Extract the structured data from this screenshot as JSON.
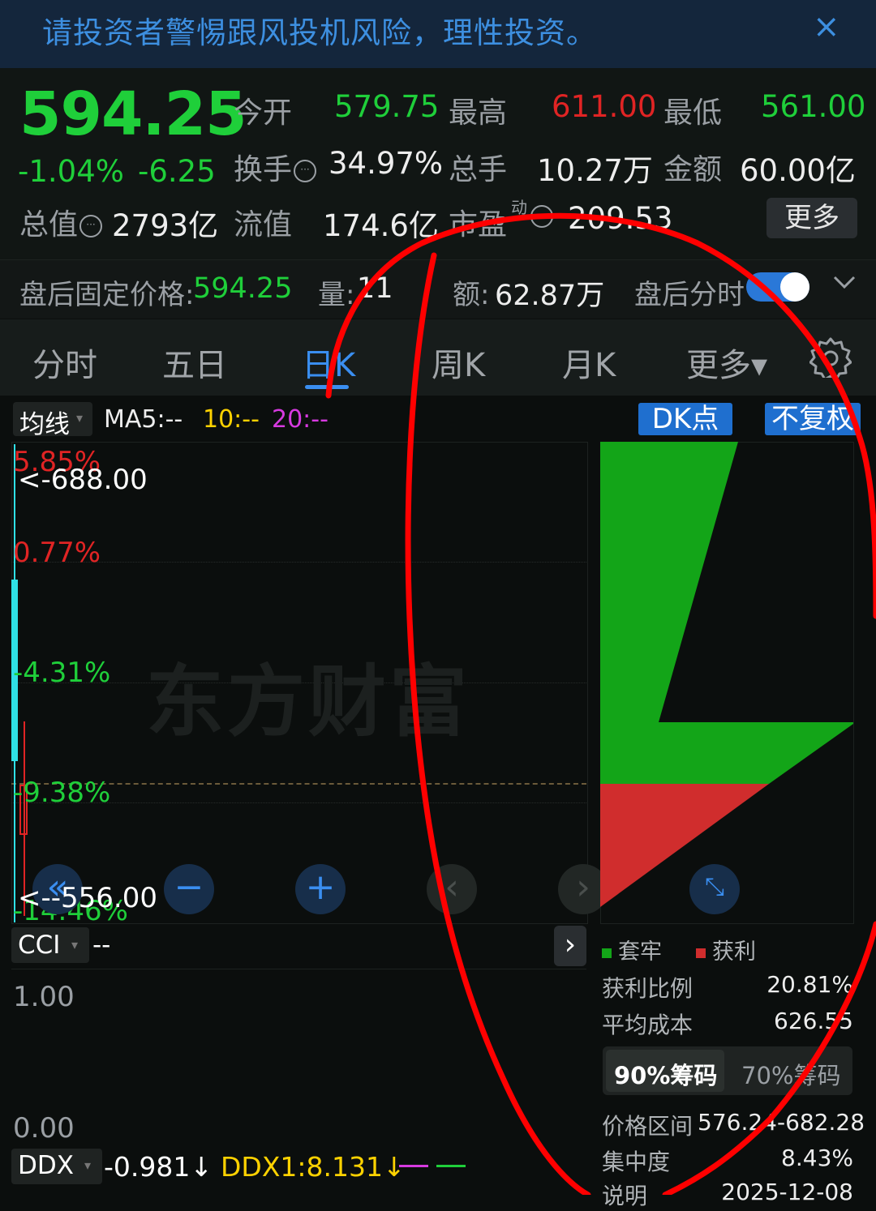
{
  "banner": {
    "text": "请投资者警惕跟风投机风险，理性投资。",
    "close_icon": "×"
  },
  "quote": {
    "price": "594.25",
    "change_pct": "-1.04%",
    "change": "-6.25",
    "open_label": "今开",
    "open": "579.75",
    "high_label": "最高",
    "high": "611.00",
    "low_label": "最低",
    "low": "561.00",
    "turnover_label": "换手",
    "turnover": "34.97%",
    "volume_label": "总手",
    "volume": "10.27万",
    "amount_label": "金额",
    "amount": "60.00亿",
    "mktcap_label": "总值",
    "mktcap": "2793亿",
    "float_label": "流值",
    "float_cap": "174.6亿",
    "pe_label": "市盈",
    "pe_sup": "动",
    "pe": "209.53",
    "more_label": "更多"
  },
  "afterhours": {
    "fixed_label": "盘后固定价格:",
    "fixed_price": "594.25",
    "vol_label": "量:",
    "vol": "11",
    "amt_label": "额:",
    "amt": "62.87万",
    "toggle_label": "盘后分时",
    "toggle_on": true
  },
  "tabs": [
    {
      "label": "分时"
    },
    {
      "label": "五日"
    },
    {
      "label": "日K",
      "active": true
    },
    {
      "label": "周K"
    },
    {
      "label": "月K"
    },
    {
      "label": "更多▾"
    }
  ],
  "toolbar": {
    "ma_select": "均线",
    "ma5": "MA5:--",
    "ma10": "10:--",
    "ma20": "20:--",
    "dk_badge": "DK点",
    "fq_badge": "不复权"
  },
  "kchart": {
    "high_marker": "<-688.00",
    "low_marker": "<--556.00",
    "pct_labels": [
      "5.85%",
      "0.77%",
      "-4.31%",
      "-9.38%",
      "-14.46%"
    ],
    "watermark": "东方财富"
  },
  "chip_legend": {
    "trapped": "套牢",
    "profit": "获利"
  },
  "chip_stats": {
    "profit_ratio_label": "获利比例",
    "profit_ratio": "20.81%",
    "avg_cost_label": "平均成本",
    "avg_cost": "626.55",
    "seg_90": "90%筹码",
    "seg_70": "70%筹码",
    "range_label": "价格区间",
    "range": "576.24-682.28",
    "concentration_label": "集中度",
    "concentration": "8.43%",
    "note_label": "说明",
    "date": "2025-12-08"
  },
  "cci": {
    "select": "CCI",
    "value": "--",
    "top": "1.00",
    "bottom": "0.00"
  },
  "ddx": {
    "select": "DDX",
    "value": "-0.981↓",
    "ddx1": "DDX1:8.131↓"
  },
  "colors": {
    "up": "#e02424",
    "down": "#1fcf3a",
    "accent": "#1f6fcf",
    "annotation": "#ff0000"
  }
}
